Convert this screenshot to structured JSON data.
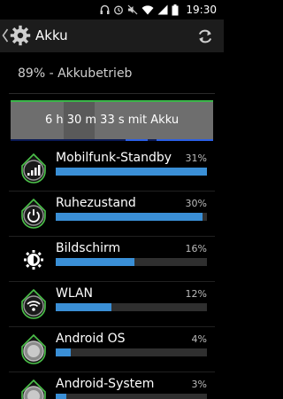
{
  "status_bar": {
    "time": "19:30",
    "icons": [
      "headset-icon",
      "alarm-icon",
      "mute-icon",
      "wifi-icon",
      "signal-icon",
      "battery-icon"
    ]
  },
  "action_bar": {
    "title": "Akku",
    "refresh_icon": "refresh-icon"
  },
  "summary": "89% - Akkubetrieb",
  "graph": {
    "label": "6 h 30 m 33 s mit Akku"
  },
  "items": [
    {
      "name": "Mobilfunk-Standby",
      "percent": "31%",
      "value": 1.0,
      "icon": "cell-standby-icon"
    },
    {
      "name": "Ruhezustand",
      "percent": "30%",
      "value": 0.97,
      "icon": "power-icon"
    },
    {
      "name": "Bildschirm",
      "percent": "16%",
      "value": 0.52,
      "icon": "brightness-icon"
    },
    {
      "name": "WLAN",
      "percent": "12%",
      "value": 0.37,
      "icon": "wifi-icon"
    },
    {
      "name": "Android OS",
      "percent": "4%",
      "value": 0.1,
      "icon": "android-os-icon"
    },
    {
      "name": "Android-System",
      "percent": "3%",
      "value": 0.07,
      "icon": "android-system-icon"
    }
  ],
  "colors": {
    "bar": "#3a8fd6",
    "track": "#2f2f2f",
    "graph_line": "#3bb54a",
    "graph_base": "#2b5fe6"
  }
}
